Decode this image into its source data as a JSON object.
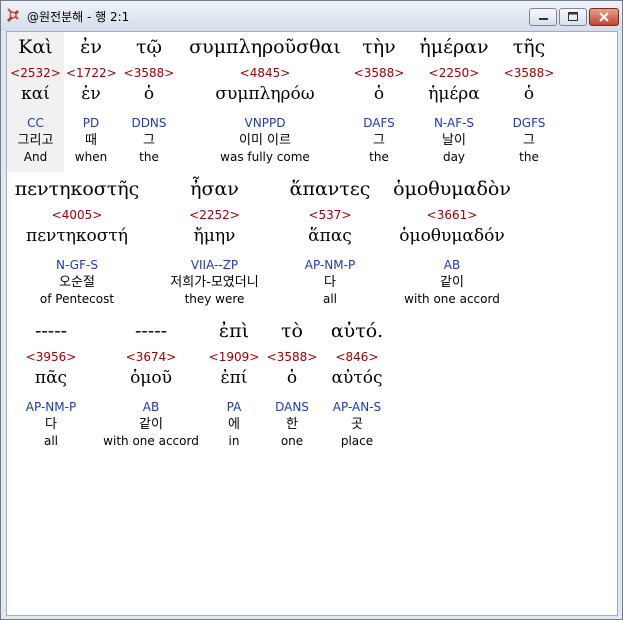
{
  "window": {
    "title": "@원전분해 - 행 2:1",
    "controls": {
      "minimize_icon": "minimize-icon",
      "maximize_icon": "maximize-icon",
      "close_icon": "close-icon"
    }
  },
  "rows": [
    {
      "tokens": [
        {
          "greek": "Καὶ",
          "num": "<2532>",
          "lemma": "καί",
          "parse": "CC",
          "korean": "그리고",
          "english": "And"
        },
        {
          "greek": "ἐν",
          "num": "<1722>",
          "lemma": "ἐν",
          "parse": "PD",
          "korean": "때",
          "english": "when"
        },
        {
          "greek": "τῷ",
          "num": "<3588>",
          "lemma": "ὁ",
          "parse": "DDNS",
          "korean": "그",
          "english": "the"
        },
        {
          "greek": "συμπληροῦσθαι",
          "num": "<4845>",
          "lemma": "συμπληρόω",
          "parse": "VNPPD",
          "korean": "이미 이르",
          "english": "was fully come"
        },
        {
          "greek": "τὴν",
          "num": "<3588>",
          "lemma": "ὁ",
          "parse": "DAFS",
          "korean": "그",
          "english": "the"
        },
        {
          "greek": "ἡμέραν",
          "num": "<2250>",
          "lemma": "ἡμέρα",
          "parse": "N-AF-S",
          "korean": "날이",
          "english": "day"
        },
        {
          "greek": "τῆς",
          "num": "<3588>",
          "lemma": "ὁ",
          "parse": "DGFS",
          "korean": "그",
          "english": "the"
        }
      ]
    },
    {
      "tokens": [
        {
          "greek": "πεντηκοστῆς",
          "num": "<4005>",
          "lemma": "πεντηκοστή",
          "parse": "N-GF-S",
          "korean": "오순절",
          "english": "of Pentecost"
        },
        {
          "greek": "ἦσαν",
          "num": "<2252>",
          "lemma": "ἤμην",
          "parse": "VIIA--ZP",
          "korean": "저희가-모였더니",
          "english": "they were"
        },
        {
          "greek": "ἅπαντες",
          "num": "<537>",
          "lemma": "ἅπας",
          "parse": "AP-NM-P",
          "korean": "다",
          "english": "all"
        },
        {
          "greek": "ὁμοθυμαδὸν",
          "num": "<3661>",
          "lemma": "ὁμοθυμαδόν",
          "parse": "AB",
          "korean": "같이",
          "english": "with one accord"
        }
      ]
    },
    {
      "tokens": [
        {
          "greek": "-----",
          "num": "<3956>",
          "lemma": "πᾶς",
          "parse": "AP-NM-P",
          "korean": "다",
          "english": "all"
        },
        {
          "greek": "-----",
          "num": "<3674>",
          "lemma": "ὁμοῦ",
          "parse": "AB",
          "korean": "같이",
          "english": "with one accord"
        },
        {
          "greek": "ἐπὶ",
          "num": "<1909>",
          "lemma": "ἐπί",
          "parse": "PA",
          "korean": "에",
          "english": "in"
        },
        {
          "greek": "τὸ",
          "num": "<3588>",
          "lemma": "ὁ",
          "parse": "DANS",
          "korean": "한",
          "english": "one"
        },
        {
          "greek": "αὐτό.",
          "num": "<846>",
          "lemma": "αὐτός",
          "parse": "AP-AN-S",
          "korean": "곳",
          "english": "place"
        }
      ]
    }
  ]
}
